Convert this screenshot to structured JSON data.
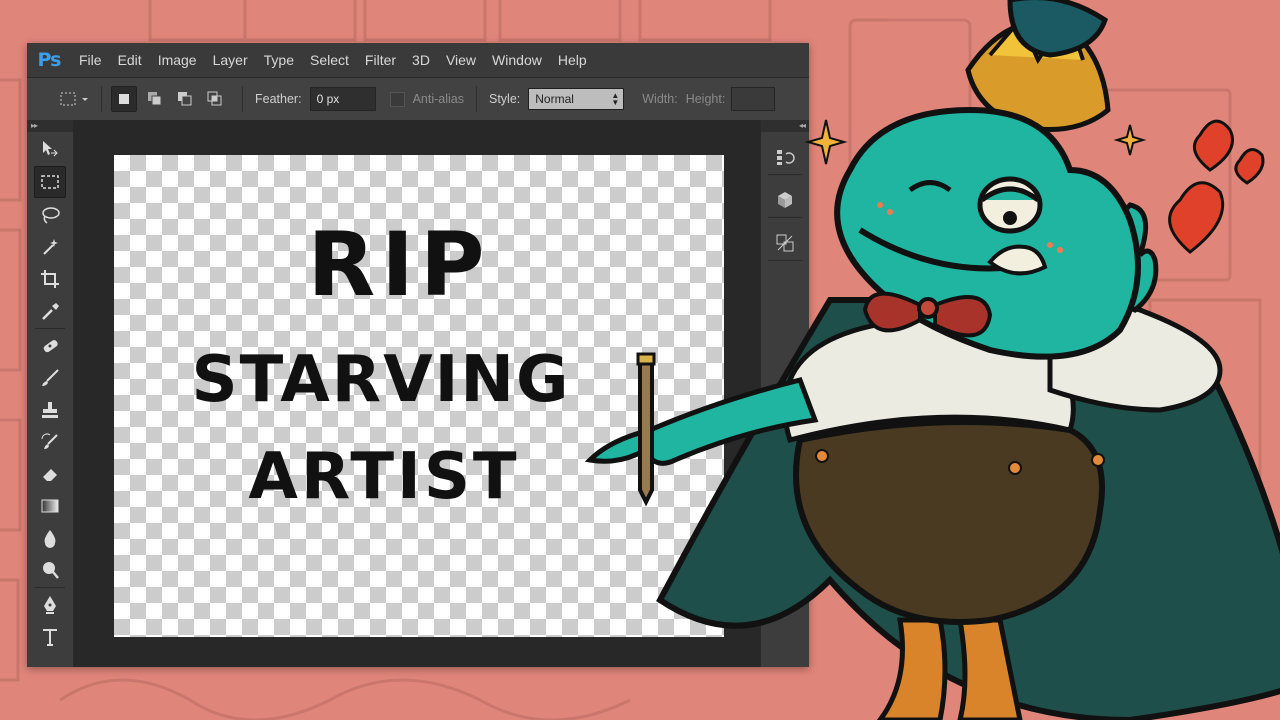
{
  "app": {
    "logo": "Ps"
  },
  "menu": [
    "File",
    "Edit",
    "Image",
    "Layer",
    "Type",
    "Select",
    "Filter",
    "3D",
    "View",
    "Window",
    "Help"
  ],
  "options": {
    "feather_label": "Feather:",
    "feather_value": "0 px",
    "antialias_label": "Anti-alias",
    "style_label": "Style:",
    "style_value": "Normal",
    "width_label": "Width:",
    "height_label": "Height:"
  },
  "canvas": {
    "line1": "RIP",
    "line2": "STARVING",
    "line3": "ARTIST"
  },
  "tools": [
    "move-icon",
    "rectangular-marquee-icon",
    "lasso-icon",
    "magic-wand-icon",
    "crop-icon",
    "eyedropper-icon",
    "healing-brush-icon",
    "brush-icon",
    "clone-stamp-icon",
    "history-brush-icon",
    "eraser-icon",
    "gradient-icon",
    "blur-icon",
    "dodge-icon",
    "pen-icon",
    "type-icon"
  ],
  "panels": [
    "history-panel-icon",
    "3d-panel-icon",
    "properties-panel-icon"
  ],
  "colors": {
    "background": "#e0857a",
    "ps_blue": "#3b9fe8",
    "frog_teal": "#1fb5a1",
    "cape": "#1f4f4a"
  }
}
